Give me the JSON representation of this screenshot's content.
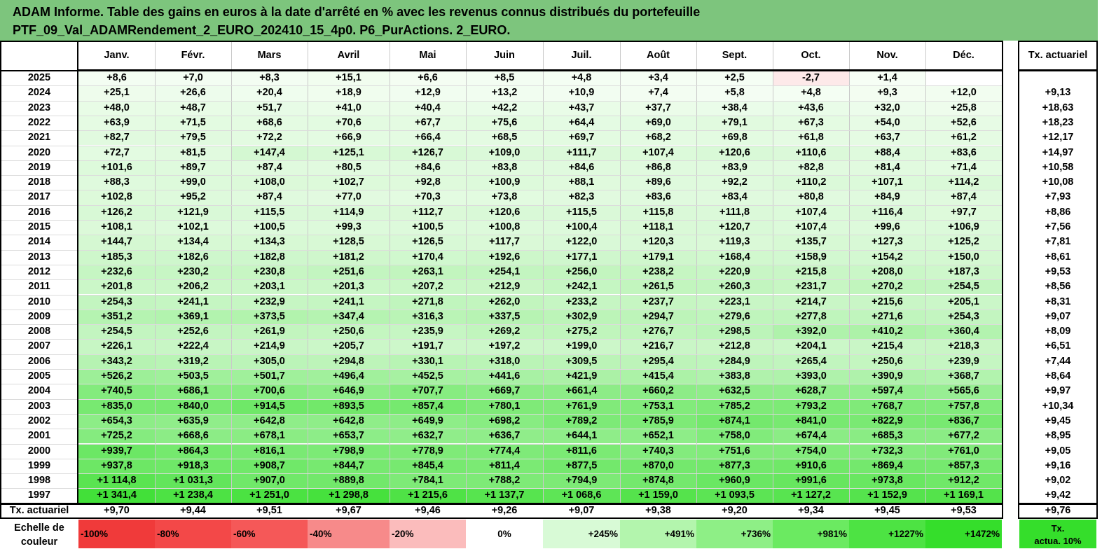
{
  "title": {
    "line1": "ADAM Informe. Table des gains en euros à la date d'arrêté en % avec les revenus connus distribués du portefeuille",
    "line2": "PTF_09_Val_ADAMRendement_2_EURO_202410_15_4p0. P6_PurActions. 2_EURO."
  },
  "months": [
    "Janv.",
    "Févr.",
    "Mars",
    "Avril",
    "Mai",
    "Juin",
    "Juil.",
    "Août",
    "Sept.",
    "Oct.",
    "Nov.",
    "Déc."
  ],
  "rate_header": "Tx. actuariel",
  "rows": [
    {
      "year": "2025",
      "values": [
        "+8,6",
        "+7,0",
        "+8,3",
        "+15,1",
        "+6,6",
        "+8,5",
        "+4,8",
        "+3,4",
        "+2,5",
        "-2,7",
        "+1,4",
        ""
      ],
      "rate": ""
    },
    {
      "year": "2024",
      "values": [
        "+25,1",
        "+26,6",
        "+20,4",
        "+18,9",
        "+12,9",
        "+13,2",
        "+10,9",
        "+7,4",
        "+5,8",
        "+4,8",
        "+9,3",
        "+12,0"
      ],
      "rate": "+9,13"
    },
    {
      "year": "2023",
      "values": [
        "+48,0",
        "+48,7",
        "+51,7",
        "+41,0",
        "+40,4",
        "+42,2",
        "+43,7",
        "+37,7",
        "+38,4",
        "+43,6",
        "+32,0",
        "+25,8"
      ],
      "rate": "+18,63"
    },
    {
      "year": "2022",
      "values": [
        "+63,9",
        "+71,5",
        "+68,6",
        "+70,6",
        "+67,7",
        "+75,6",
        "+64,4",
        "+69,0",
        "+79,1",
        "+67,3",
        "+54,0",
        "+52,6"
      ],
      "rate": "+18,23"
    },
    {
      "year": "2021",
      "values": [
        "+82,7",
        "+79,5",
        "+72,2",
        "+66,9",
        "+66,4",
        "+68,5",
        "+69,7",
        "+68,2",
        "+69,8",
        "+61,8",
        "+63,7",
        "+61,2"
      ],
      "rate": "+12,17"
    },
    {
      "year": "2020",
      "values": [
        "+72,7",
        "+81,5",
        "+147,4",
        "+125,1",
        "+126,7",
        "+109,0",
        "+111,7",
        "+107,4",
        "+120,6",
        "+110,6",
        "+88,4",
        "+83,6"
      ],
      "rate": "+14,97"
    },
    {
      "year": "2019",
      "values": [
        "+101,6",
        "+89,7",
        "+87,4",
        "+80,5",
        "+84,6",
        "+83,8",
        "+84,6",
        "+86,8",
        "+83,9",
        "+82,8",
        "+81,4",
        "+71,4"
      ],
      "rate": "+10,58"
    },
    {
      "year": "2018",
      "values": [
        "+88,3",
        "+99,0",
        "+108,0",
        "+102,7",
        "+92,8",
        "+100,9",
        "+88,1",
        "+89,6",
        "+92,2",
        "+110,2",
        "+107,1",
        "+114,2"
      ],
      "rate": "+10,08"
    },
    {
      "year": "2017",
      "values": [
        "+102,8",
        "+95,2",
        "+87,4",
        "+77,0",
        "+70,3",
        "+73,8",
        "+82,3",
        "+83,6",
        "+83,4",
        "+80,8",
        "+84,9",
        "+87,4"
      ],
      "rate": "+7,93"
    },
    {
      "year": "2016",
      "values": [
        "+126,2",
        "+121,9",
        "+115,5",
        "+114,9",
        "+112,7",
        "+120,6",
        "+115,5",
        "+115,8",
        "+111,8",
        "+107,4",
        "+116,4",
        "+97,7"
      ],
      "rate": "+8,86"
    },
    {
      "year": "2015",
      "values": [
        "+108,1",
        "+102,1",
        "+100,5",
        "+99,3",
        "+100,5",
        "+100,8",
        "+100,4",
        "+118,1",
        "+120,7",
        "+107,4",
        "+99,6",
        "+106,9"
      ],
      "rate": "+7,56"
    },
    {
      "year": "2014",
      "values": [
        "+144,7",
        "+134,4",
        "+134,3",
        "+128,5",
        "+126,5",
        "+117,7",
        "+122,0",
        "+120,3",
        "+119,3",
        "+135,7",
        "+127,3",
        "+125,2"
      ],
      "rate": "+7,81"
    },
    {
      "year": "2013",
      "values": [
        "+185,3",
        "+182,6",
        "+182,8",
        "+181,2",
        "+170,4",
        "+192,6",
        "+177,1",
        "+179,1",
        "+168,4",
        "+158,9",
        "+154,2",
        "+150,0"
      ],
      "rate": "+8,61"
    },
    {
      "year": "2012",
      "values": [
        "+232,6",
        "+230,2",
        "+230,8",
        "+251,6",
        "+263,1",
        "+254,1",
        "+256,0",
        "+238,2",
        "+220,9",
        "+215,8",
        "+208,0",
        "+187,3"
      ],
      "rate": "+9,53"
    },
    {
      "year": "2011",
      "values": [
        "+201,8",
        "+206,2",
        "+203,1",
        "+201,3",
        "+207,2",
        "+212,9",
        "+242,1",
        "+261,5",
        "+260,3",
        "+231,7",
        "+270,2",
        "+254,5"
      ],
      "rate": "+8,56"
    },
    {
      "year": "2010",
      "values": [
        "+254,3",
        "+241,1",
        "+232,9",
        "+241,1",
        "+271,8",
        "+262,0",
        "+233,2",
        "+237,7",
        "+223,1",
        "+214,7",
        "+215,6",
        "+205,1"
      ],
      "rate": "+8,31"
    },
    {
      "year": "2009",
      "values": [
        "+351,2",
        "+369,1",
        "+373,5",
        "+347,4",
        "+316,3",
        "+337,5",
        "+302,9",
        "+294,7",
        "+279,6",
        "+277,8",
        "+271,6",
        "+254,3"
      ],
      "rate": "+9,07"
    },
    {
      "year": "2008",
      "values": [
        "+254,5",
        "+252,6",
        "+261,9",
        "+250,6",
        "+235,9",
        "+269,2",
        "+275,2",
        "+276,7",
        "+298,5",
        "+392,0",
        "+410,2",
        "+360,4"
      ],
      "rate": "+8,09"
    },
    {
      "year": "2007",
      "values": [
        "+226,1",
        "+222,4",
        "+214,9",
        "+205,7",
        "+191,7",
        "+197,2",
        "+199,0",
        "+216,7",
        "+212,8",
        "+204,1",
        "+215,4",
        "+218,3"
      ],
      "rate": "+6,51"
    },
    {
      "year": "2006",
      "values": [
        "+343,2",
        "+319,2",
        "+305,0",
        "+294,8",
        "+330,1",
        "+318,0",
        "+309,5",
        "+295,4",
        "+284,9",
        "+265,4",
        "+250,6",
        "+239,9"
      ],
      "rate": "+7,44"
    },
    {
      "year": "2005",
      "values": [
        "+526,2",
        "+503,5",
        "+501,7",
        "+496,4",
        "+452,5",
        "+441,6",
        "+421,9",
        "+415,4",
        "+383,8",
        "+393,0",
        "+390,9",
        "+368,7"
      ],
      "rate": "+8,64"
    },
    {
      "year": "2004",
      "values": [
        "+740,5",
        "+686,1",
        "+700,6",
        "+646,9",
        "+707,7",
        "+669,7",
        "+661,4",
        "+660,2",
        "+632,5",
        "+628,7",
        "+597,4",
        "+565,6"
      ],
      "rate": "+9,97"
    },
    {
      "year": "2003",
      "values": [
        "+835,0",
        "+840,0",
        "+914,5",
        "+893,5",
        "+857,4",
        "+780,1",
        "+761,9",
        "+753,1",
        "+785,2",
        "+793,2",
        "+768,7",
        "+757,8"
      ],
      "rate": "+10,34"
    },
    {
      "year": "2002",
      "values": [
        "+654,3",
        "+635,9",
        "+642,8",
        "+642,8",
        "+649,9",
        "+698,2",
        "+789,2",
        "+785,9",
        "+874,1",
        "+841,0",
        "+822,9",
        "+836,7"
      ],
      "rate": "+9,45"
    },
    {
      "year": "2001",
      "values": [
        "+725,2",
        "+668,6",
        "+678,1",
        "+653,7",
        "+632,7",
        "+636,7",
        "+644,1",
        "+652,1",
        "+758,0",
        "+674,4",
        "+685,3",
        "+677,2"
      ],
      "rate": "+8,95"
    },
    {
      "year": "2000",
      "values": [
        "+939,7",
        "+864,3",
        "+816,1",
        "+798,9",
        "+778,9",
        "+774,4",
        "+811,6",
        "+740,3",
        "+751,6",
        "+754,0",
        "+732,3",
        "+761,0"
      ],
      "rate": "+9,05"
    },
    {
      "year": "1999",
      "values": [
        "+937,8",
        "+918,3",
        "+908,7",
        "+844,7",
        "+845,4",
        "+811,4",
        "+877,5",
        "+870,0",
        "+877,3",
        "+910,6",
        "+869,4",
        "+857,3"
      ],
      "rate": "+9,16"
    },
    {
      "year": "1998",
      "values": [
        "+1 114,8",
        "+1 031,3",
        "+907,0",
        "+889,8",
        "+784,1",
        "+788,2",
        "+794,9",
        "+874,8",
        "+960,9",
        "+991,6",
        "+973,8",
        "+912,2"
      ],
      "rate": "+9,02"
    },
    {
      "year": "1997",
      "values": [
        "+1 341,4",
        "+1 238,4",
        "+1 251,0",
        "+1 298,8",
        "+1 215,6",
        "+1 137,7",
        "+1 068,6",
        "+1 159,0",
        "+1 093,5",
        "+1 127,2",
        "+1 152,9",
        "+1 169,1"
      ],
      "rate": "+9,42"
    }
  ],
  "footer": {
    "label": "Tx. actuariel",
    "values": [
      "+9,70",
      "+9,44",
      "+9,51",
      "+9,67",
      "+9,46",
      "+9,26",
      "+9,07",
      "+9,38",
      "+9,20",
      "+9,34",
      "+9,45",
      "+9,53"
    ],
    "rate": "+9,76"
  },
  "scale": {
    "label_line1": "Echelle de",
    "label_line2": "couleur",
    "items": [
      {
        "text": "-100%",
        "color": "#f03a3a"
      },
      {
        "text": "-80%",
        "color": "#f34848"
      },
      {
        "text": "-60%",
        "color": "#f55858"
      },
      {
        "text": "-40%",
        "color": "#f78a8a"
      },
      {
        "text": "-20%",
        "color": "#fbbcbc"
      },
      {
        "text": "0%",
        "color": "#ffffff"
      },
      {
        "text": "+245%",
        "color": "#d8fad6"
      },
      {
        "text": "+491%",
        "color": "#b3f5ad"
      },
      {
        "text": "+736%",
        "color": "#8eef86"
      },
      {
        "text": "+981%",
        "color": "#6bea61"
      },
      {
        "text": "+1227%",
        "color": "#4de343"
      },
      {
        "text": "+1472%",
        "color": "#35de2b"
      }
    ],
    "rate_line1": "Tx.",
    "rate_line2": "actua. 10%",
    "rate_color": "#35de2b"
  },
  "colors": {
    "title_bg": "#7dc57d",
    "positive_max": "#35de2b",
    "negative_light": "#fde9e9"
  }
}
